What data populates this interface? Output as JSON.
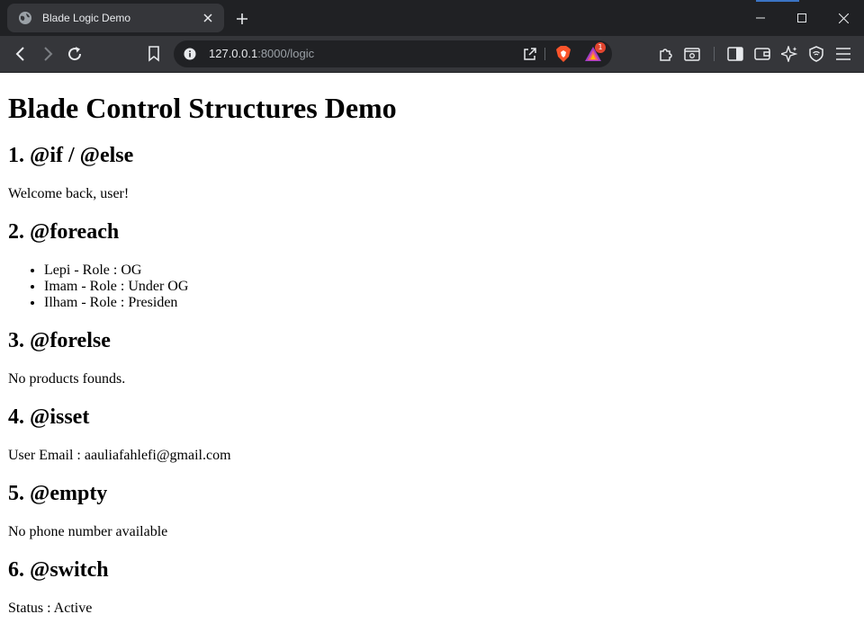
{
  "browser": {
    "tab": {
      "title": "Blade Logic Demo",
      "icon": "globe-icon"
    },
    "omnibox": {
      "url_host": "127.0.0.1",
      "url_rest": ":8000/logic"
    },
    "rewards_badge": "1"
  },
  "page": {
    "title": "Blade Control Structures Demo",
    "sections": {
      "if_else": {
        "heading": "1. @if / @else",
        "text": "Welcome back, user!"
      },
      "foreach": {
        "heading": "2. @foreach",
        "items": [
          "Lepi - Role : OG",
          "Imam - Role : Under OG",
          "Ilham - Role : Presiden"
        ]
      },
      "forelse": {
        "heading": "3. @forelse",
        "text": "No products founds."
      },
      "isset": {
        "heading": "4. @isset",
        "text": "User Email : aauliafahlefi@gmail.com"
      },
      "empty": {
        "heading": "5. @empty",
        "text": "No phone number available"
      },
      "switch": {
        "heading": "6. @switch",
        "text": "Status : Active"
      }
    }
  },
  "colors": {
    "chrome_bg": "#202124",
    "toolbar_bg": "#35363a",
    "brave_orange": "#fb542b",
    "badge_red": "#e2452f"
  }
}
